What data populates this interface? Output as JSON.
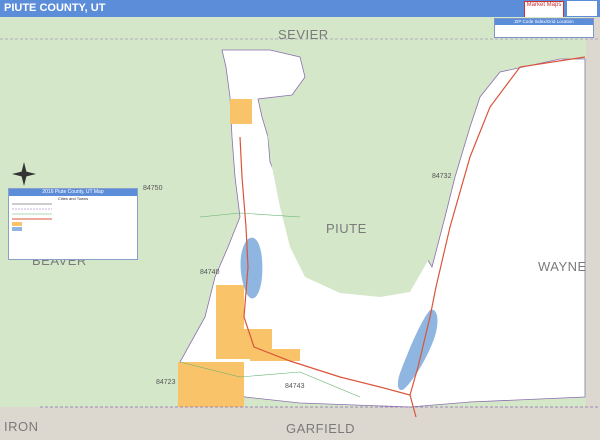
{
  "title": "PIUTE COUNTY, UT",
  "logo_text": "Market Maps",
  "counties": {
    "north": "SEVIER",
    "center": "PIUTE",
    "west": "BEAVER",
    "east": "WAYNE",
    "south": "GARFIELD",
    "southwest": "IRON"
  },
  "zip_codes": [
    "84750",
    "84732",
    "84740",
    "84723",
    "84743"
  ],
  "legend": {
    "title": "2016 Piute County, UT Map",
    "subtitle": "Cities and Towns"
  },
  "zip_index": {
    "title": "ZIP Code Index/Grid Location"
  },
  "colors": {
    "title_bar": "#5b8dd9",
    "county_fill": "#ffffff",
    "neighbor_fill": "#d4e8c9",
    "city_fill": "#f9c36a",
    "water": "#8fb6e0",
    "highway": "#d9553a",
    "gray_region": "#ddd8cf"
  }
}
